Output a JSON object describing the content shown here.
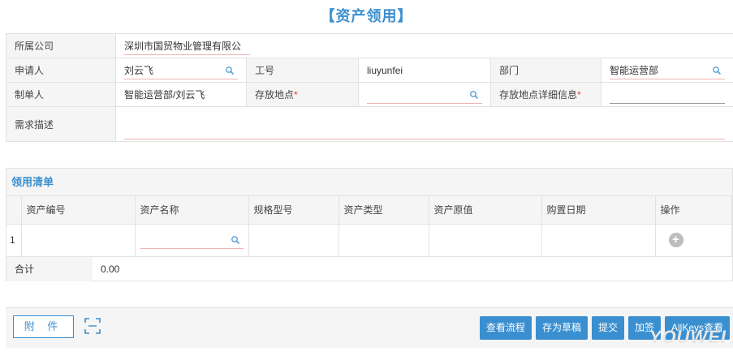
{
  "page": {
    "title": "【资产领用】"
  },
  "form": {
    "company": {
      "label": "所属公司",
      "value": "深圳市国贸物业管理有限公"
    },
    "applicant": {
      "label": "申请人",
      "value": "刘云飞"
    },
    "job_no": {
      "label": "工号",
      "value": "liuyunfei"
    },
    "department": {
      "label": "部门",
      "value": "智能运营部"
    },
    "creator": {
      "label": "制单人",
      "value": "智能运营部/刘云飞"
    },
    "location": {
      "label": "存放地点",
      "required": "*",
      "value": ""
    },
    "location_detail": {
      "label": "存放地点详细信息",
      "required": "*",
      "value": ""
    },
    "description": {
      "label": "需求描述",
      "value": ""
    }
  },
  "list": {
    "title": "领用清单",
    "columns": [
      "",
      "资产编号",
      "资产名称",
      "规格型号",
      "资产类型",
      "资产原值",
      "购置日期",
      "操作"
    ],
    "rows": [
      {
        "index": "1",
        "asset_no": "",
        "asset_name": "",
        "spec": "",
        "type": "",
        "value": "",
        "date": ""
      }
    ],
    "total_label": "合计",
    "total_value": "0.00"
  },
  "footer": {
    "attach_label": "附 件",
    "buttons": [
      "查看流程",
      "存为草稿",
      "提交",
      "加签",
      "AllKeys查看"
    ]
  },
  "icons": {
    "search": "search-icon",
    "add": "add-circle-icon",
    "expand": "expand-icon"
  },
  "colors": {
    "accent": "#3a8fd0",
    "required": "#e0393e",
    "field_border": "#f1b2b6"
  },
  "watermark": "YOUWEI"
}
